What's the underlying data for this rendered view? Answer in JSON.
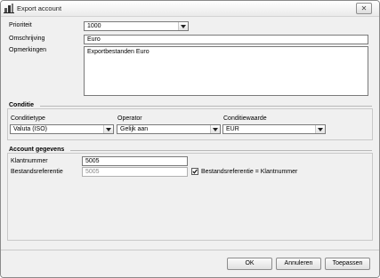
{
  "window": {
    "title": "Export account",
    "close_glyph": "✕"
  },
  "form": {
    "prioriteit": {
      "label": "Prioriteit",
      "value": "1000"
    },
    "omschrijving": {
      "label": "Omschrijving",
      "value": "Euro"
    },
    "opmerkingen": {
      "label": "Opmerkingen",
      "value": "Exportbestanden Euro"
    }
  },
  "conditie": {
    "heading": "Conditie",
    "type": {
      "label": "Conditietype",
      "value": "Valuta (ISO)"
    },
    "operator": {
      "label": "Operator",
      "value": "Gelijk aan"
    },
    "waarde": {
      "label": "Conditiewaarde",
      "value": "EUR"
    }
  },
  "account": {
    "heading": "Account gegevens",
    "klantnummer": {
      "label": "Klantnummer",
      "value": "5005"
    },
    "bestandsreferentie": {
      "label": "Bestandsreferentie",
      "value": "5005",
      "checkbox_label": "Bestandsreferentie = Klantnummer",
      "checked": true
    }
  },
  "buttons": {
    "ok": "OK",
    "cancel": "Annuleren",
    "apply": "Toepassen"
  },
  "icons": {
    "app": "export-account-icon",
    "close": "close-icon",
    "dropdown": "chevron-down-icon",
    "check": "checkmark-icon"
  }
}
